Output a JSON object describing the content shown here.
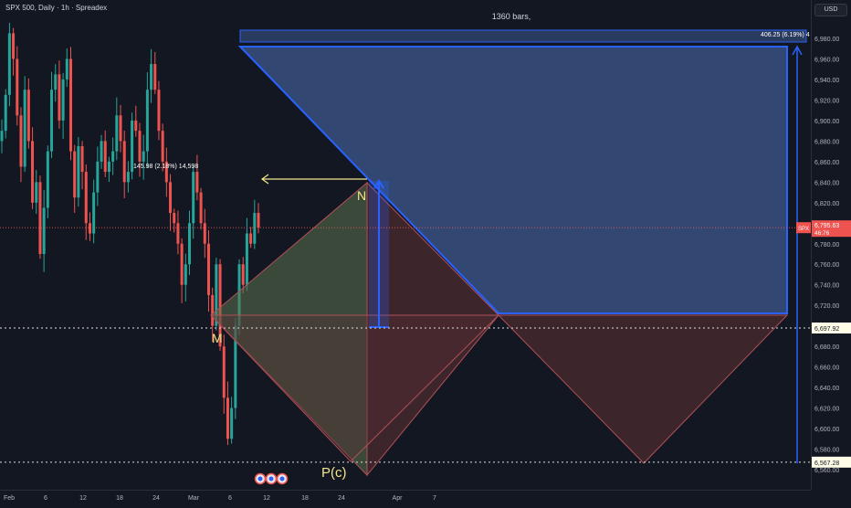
{
  "header": {
    "symbol_title": "SPX 500, Daily · 1h · Spreadex",
    "currency": "USD"
  },
  "colors": {
    "background": "#131722",
    "candle_up": "#26a69a",
    "candle_down": "#ef5350",
    "projection_fill": "#3d5a8f",
    "projection_line": "#2962ff",
    "triangle_fill": "#5a2f33",
    "triangle_green": "#5c7350",
    "measure_arrow": "#f4e78a",
    "price_tag": "#ef5350",
    "level_tag": "#fffde7"
  },
  "price_axis": {
    "ticks": [
      "6,980.00",
      "6,960.00",
      "6,940.00",
      "6,920.00",
      "6,900.00",
      "6,880.00",
      "6,860.00",
      "6,840.00",
      "6,820.00",
      "6,800.00",
      "6,780.00",
      "6,760.00",
      "6,740.00",
      "6,720.00",
      "6,700.00",
      "6,680.00",
      "6,660.00",
      "6,640.00",
      "6,620.00",
      "6,600.00",
      "6,580.00",
      "6,560.00"
    ],
    "current_symbol": "SPX",
    "current_price": "6,795.63",
    "current_countdown": "46:76",
    "level_upper": "6,697.92",
    "level_lower": "6,567.28"
  },
  "time_axis": {
    "labels": [
      "Feb",
      "6",
      "12",
      "18",
      "24",
      "Mar",
      "6",
      "12",
      "18",
      "24",
      "Apr",
      "7"
    ]
  },
  "annotations": {
    "bars_label": "1360 bars,",
    "range_label": "406.25 (6.19%) 4",
    "measure_label": "145.98 (2.18%) 14,598",
    "point_m": "M",
    "point_n": "N",
    "point_pc": "P(c)"
  },
  "chart_data": {
    "type": "candlestick",
    "title": "SPX 500, Daily · 1h · Spreadex",
    "xlabel": "",
    "ylabel": "",
    "x_axis_labels": [
      "Feb",
      "6",
      "12",
      "18",
      "24",
      "Mar",
      "6",
      "12",
      "18",
      "24",
      "Apr",
      "7"
    ],
    "ylim": [
      6550,
      6995
    ],
    "grid": false,
    "price_close_approx": [
      6890,
      6925,
      6985,
      6960,
      6905,
      6855,
      6930,
      6880,
      6820,
      6840,
      6770,
      6815,
      6870,
      6930,
      6945,
      6900,
      6940,
      6960,
      6870,
      6825,
      6875,
      6850,
      6800,
      6790,
      6830,
      6860,
      6880,
      6850,
      6860,
      6870,
      6905,
      6880,
      6840,
      6850,
      6900,
      6890,
      6860,
      6870,
      6930,
      6955,
      6930,
      6890,
      6860,
      6840,
      6810,
      6800,
      6780,
      6740,
      6760,
      6800,
      6850,
      6830,
      6800,
      6780,
      6730,
      6700,
      6760,
      6680,
      6630,
      6590,
      6620,
      6700,
      6760,
      6740,
      6790,
      6780,
      6810,
      6795.63
    ],
    "levels": [
      6697.92,
      6567.28
    ],
    "current_price": 6795.63,
    "measurements": [
      {
        "label": "406.25 (6.19%)",
        "from": 6567.28,
        "to": 6973.5
      },
      {
        "label": "145.98 (2.18%)",
        "from": 6697.92,
        "to": 6843.9
      }
    ]
  }
}
